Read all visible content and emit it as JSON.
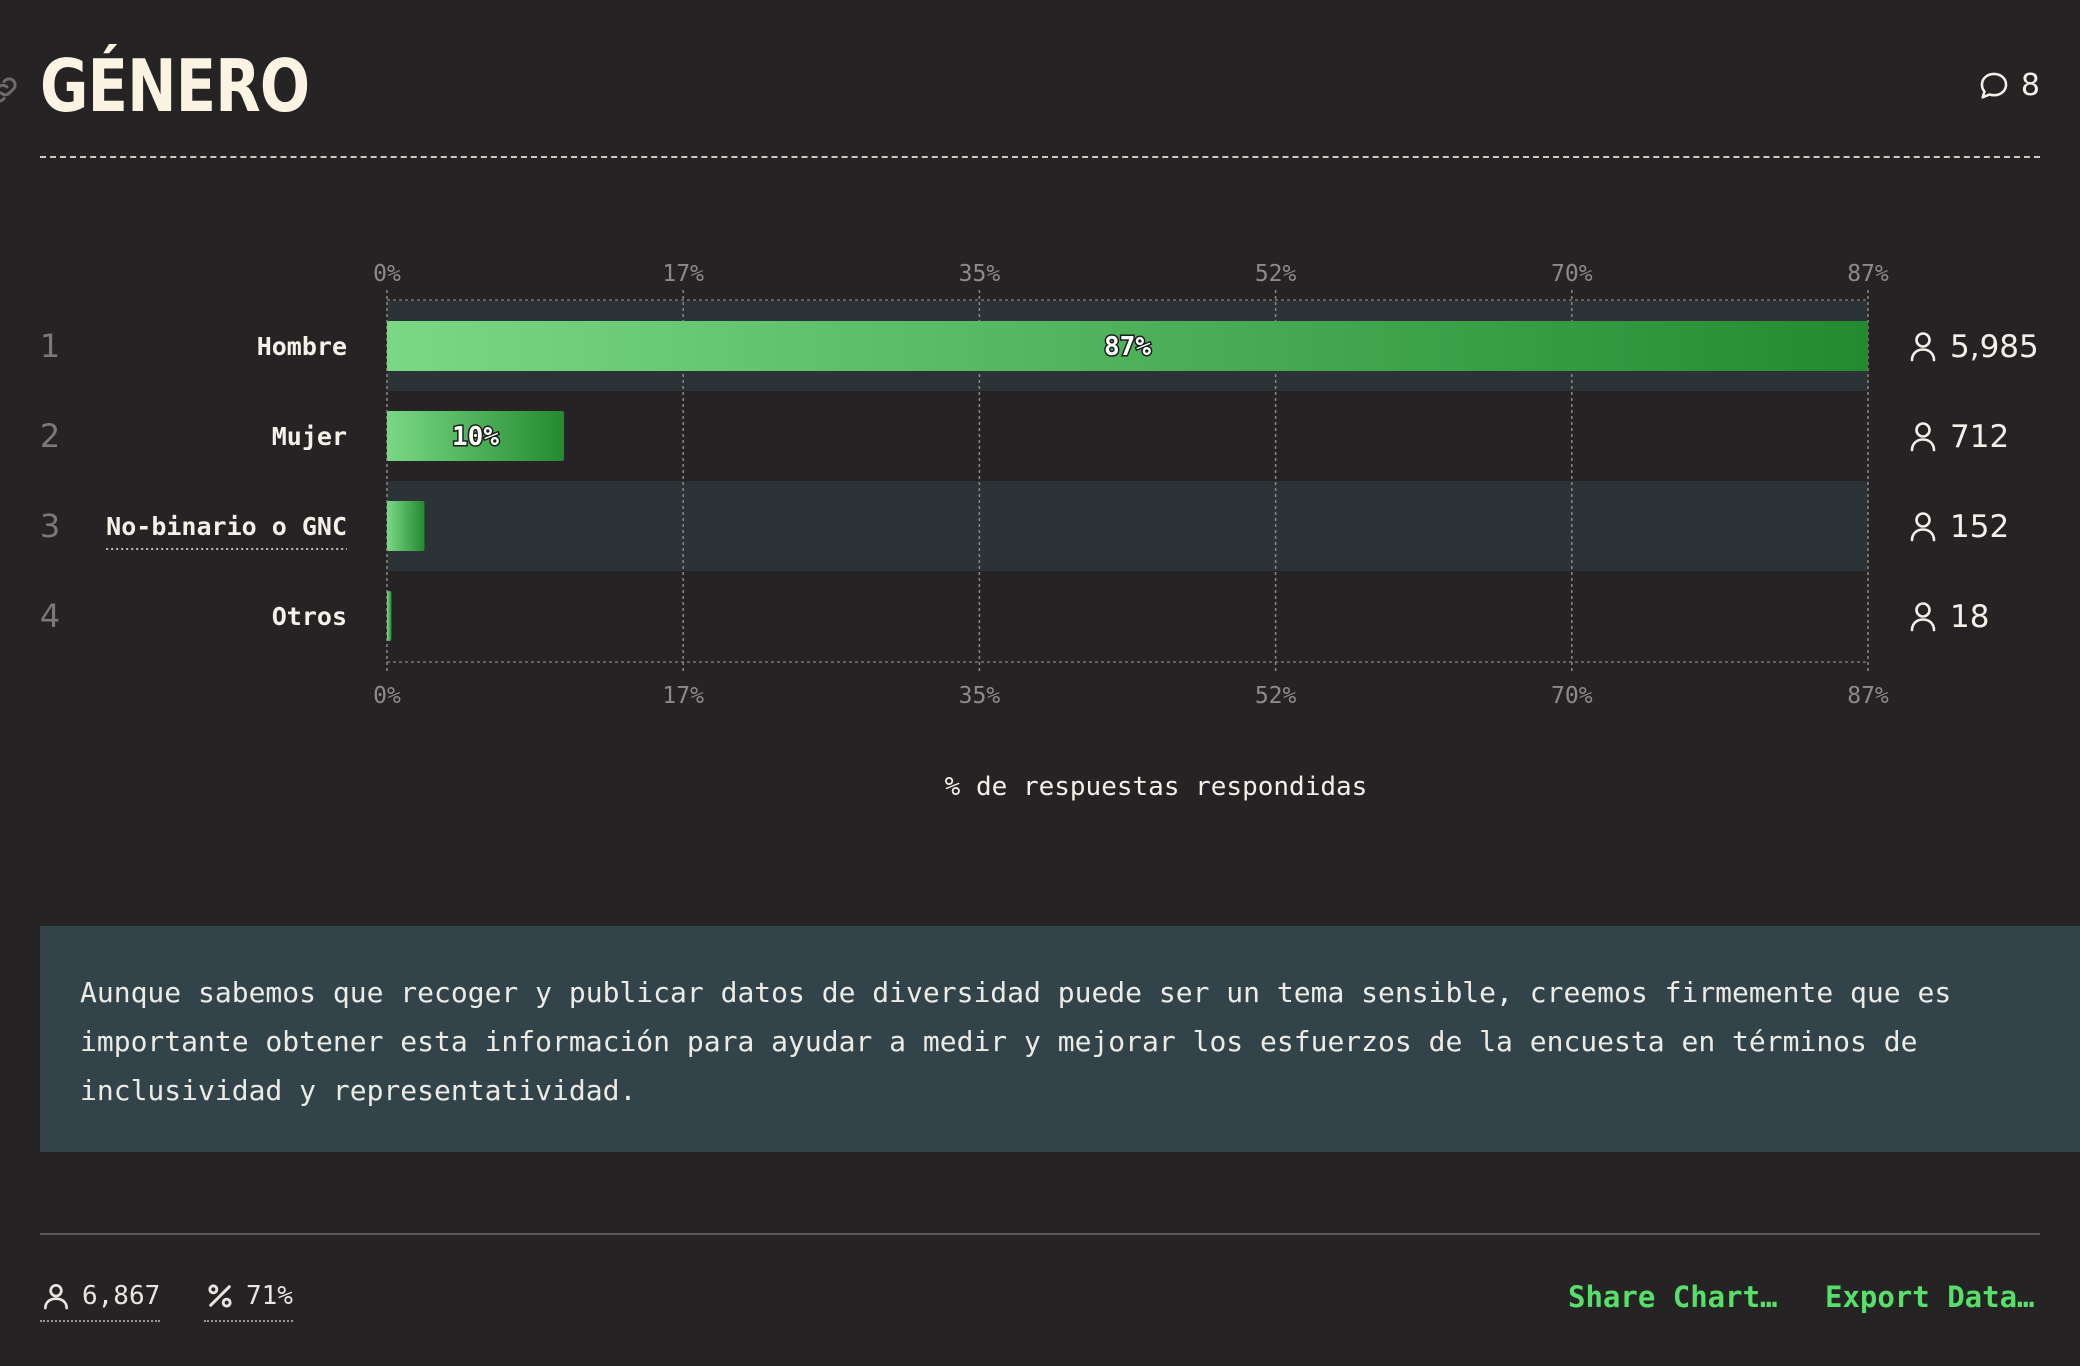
{
  "header": {
    "title": "GÉNERO",
    "comment_count": "8"
  },
  "colors": {
    "background": "#262325",
    "bar_light": "#79d884",
    "bar_dark": "#248a30",
    "row_highlight": "#2c3336",
    "note_background": "#32444a",
    "action_green": "#56e06a"
  },
  "chart_data": {
    "type": "bar",
    "orientation": "horizontal",
    "xlabel": "% de respuestas respondidas",
    "xlim": [
      0,
      87
    ],
    "ticks": [
      "0%",
      "17%",
      "35%",
      "52%",
      "70%",
      "87%"
    ],
    "tick_values": [
      0,
      17.4,
      34.8,
      52.2,
      69.6,
      87
    ],
    "grid": true,
    "categories": [
      {
        "rank": "1",
        "label": "Hombre",
        "value": 87,
        "value_label": "87%",
        "count": "5,985",
        "highlight": true
      },
      {
        "rank": "2",
        "label": "Mujer",
        "value": 10.4,
        "value_label": "10%",
        "count": "712",
        "highlight": false
      },
      {
        "rank": "3",
        "label": "No-binario o GNC",
        "value": 2.2,
        "value_label": "",
        "count": "152",
        "highlight": true,
        "underlined": true
      },
      {
        "rank": "4",
        "label": "Otros",
        "value": 0.26,
        "value_label": "",
        "count": "18",
        "highlight": false
      }
    ]
  },
  "note": {
    "text": "Aunque sabemos que recoger y publicar datos de diversidad puede ser un tema sensible, creemos firmemente que es importante obtener esta información para ayudar a medir y mejorar los esfuerzos de la encuesta en términos de inclusividad y representatividad."
  },
  "footer": {
    "respondents": "6,867",
    "percent": "71%",
    "share_label": "Share Chart…",
    "export_label": "Export Data…"
  }
}
